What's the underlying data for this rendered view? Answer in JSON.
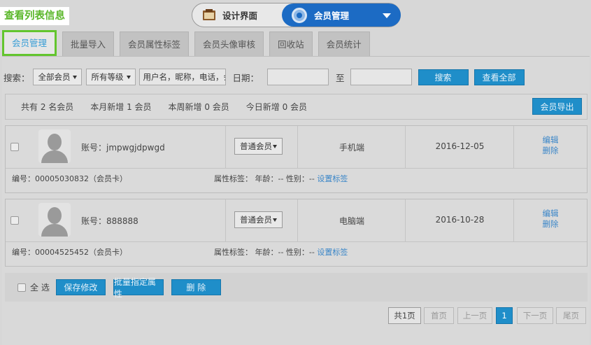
{
  "hint_label": "查看列表信息",
  "switcher": {
    "design_label": "设计界面",
    "member_label": "会员管理"
  },
  "tabs": [
    {
      "label": "会员管理",
      "active": true
    },
    {
      "label": "批量导入"
    },
    {
      "label": "会员属性标签"
    },
    {
      "label": "会员头像审核"
    },
    {
      "label": "回收站"
    },
    {
      "label": "会员统计"
    }
  ],
  "search": {
    "label": "搜索：",
    "member_filter": "全部会员",
    "level_filter": "所有等级",
    "keyword_placeholder": "用户名，昵称，电话，会",
    "date_label": "日期：",
    "date_to": "至",
    "search_button": "搜索",
    "view_all_button": "查看全部"
  },
  "stats": {
    "total": "共有 2 名会员",
    "month_new": "本月新增 1 会员",
    "week_new": "本周新增 0 会员",
    "today_new": "今日新增 0 会员",
    "export_button": "会员导出"
  },
  "members": [
    {
      "account": "账号：jmpwgjdpwgd",
      "level": "普通会员",
      "client": "手机端",
      "date": "2016-12-05",
      "edit": "编辑",
      "delete": "删除",
      "id_text": "编号：00005030832（会员卡）",
      "attr_text": "属性标签：  年龄：--    性别：--",
      "set_tag": "设置标签"
    },
    {
      "account": "账号：888888",
      "level": "普通会员",
      "client": "电脑端",
      "date": "2016-10-28",
      "edit": "编辑",
      "delete": "删除",
      "id_text": "编号：00004525452（会员卡）",
      "attr_text": "属性标签：  年龄：--    性别：--",
      "set_tag": "设置标签"
    }
  ],
  "actions": {
    "select_all": "全 选",
    "save": "保存修改",
    "batch_attr": "批量指定属性",
    "delete": "删 除"
  },
  "pagination": {
    "total": "共1页",
    "first": "首页",
    "prev": "上一页",
    "current": "1",
    "next": "下一页",
    "last": "尾页"
  }
}
